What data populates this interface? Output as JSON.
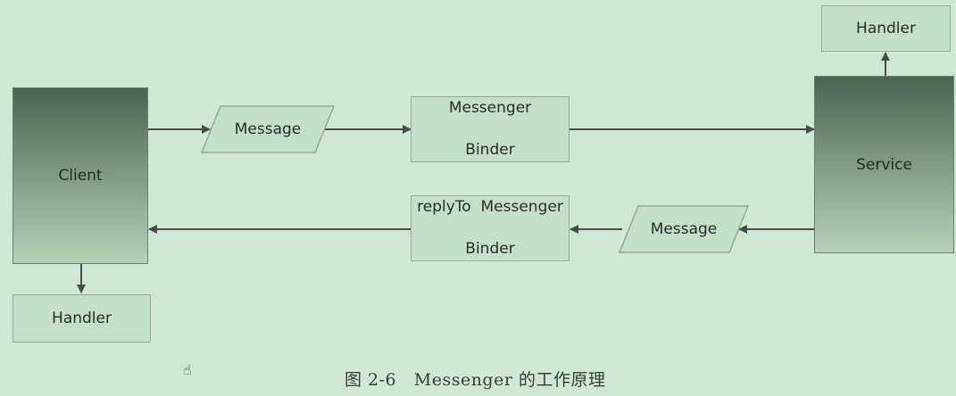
{
  "nodes": {
    "client": "Client",
    "service": "Service",
    "client_handler": "Handler",
    "service_handler": "Handler",
    "message_forward": "Message",
    "message_reply": "Message",
    "messenger_binder": {
      "top": "Messenger",
      "bottom": "Binder"
    },
    "replyto_binder": {
      "top": "replyTo  Messenger",
      "bottom": "Binder"
    }
  },
  "caption": "图 2-6   Messenger 的工作原理",
  "colors": {
    "background": "#cfe8d4",
    "box_fill": "#c3e0c9",
    "box_border": "#9aa69c",
    "arrow": "#4a4a4a"
  }
}
